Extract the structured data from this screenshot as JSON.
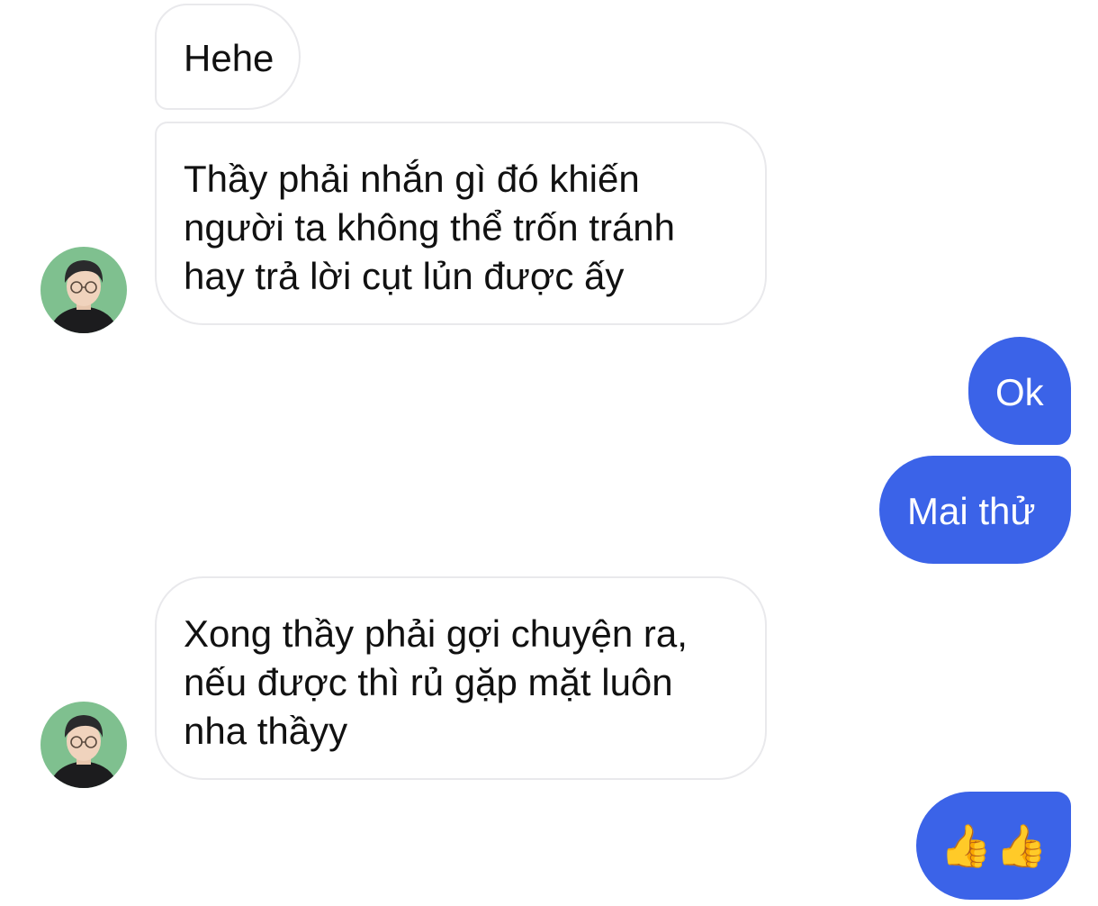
{
  "messages": [
    {
      "id": "m1",
      "side": "incoming",
      "lines": [
        "Hehe"
      ]
    },
    {
      "id": "m2",
      "side": "incoming",
      "lines": [
        "Thầy phải nhắn gì đó khiến",
        "người ta không thể trốn tránh",
        "hay trả lời cụt lủn được ấy"
      ]
    },
    {
      "id": "m3",
      "side": "outgoing",
      "lines": [
        "Ok"
      ]
    },
    {
      "id": "m4",
      "side": "outgoing",
      "lines": [
        "Mai thử"
      ]
    },
    {
      "id": "m5",
      "side": "incoming",
      "lines": [
        "Xong thầy phải gợi chuyện ra,",
        "nếu được thì rủ gặp mặt luôn",
        "nha thầyy"
      ]
    },
    {
      "id": "m6",
      "side": "outgoing",
      "lines": [
        "👍👍"
      ]
    }
  ],
  "reactions": {
    "thumbs_emoji": [
      "👍",
      "👍"
    ]
  },
  "colors": {
    "outgoing_bubble": "#3b63e8",
    "incoming_border": "#e9e9ec",
    "avatar_bg": "#7fc08f"
  },
  "icons": {
    "avatar": "contact-avatar-photo",
    "thumbs": "thumbs-up-emoji"
  }
}
